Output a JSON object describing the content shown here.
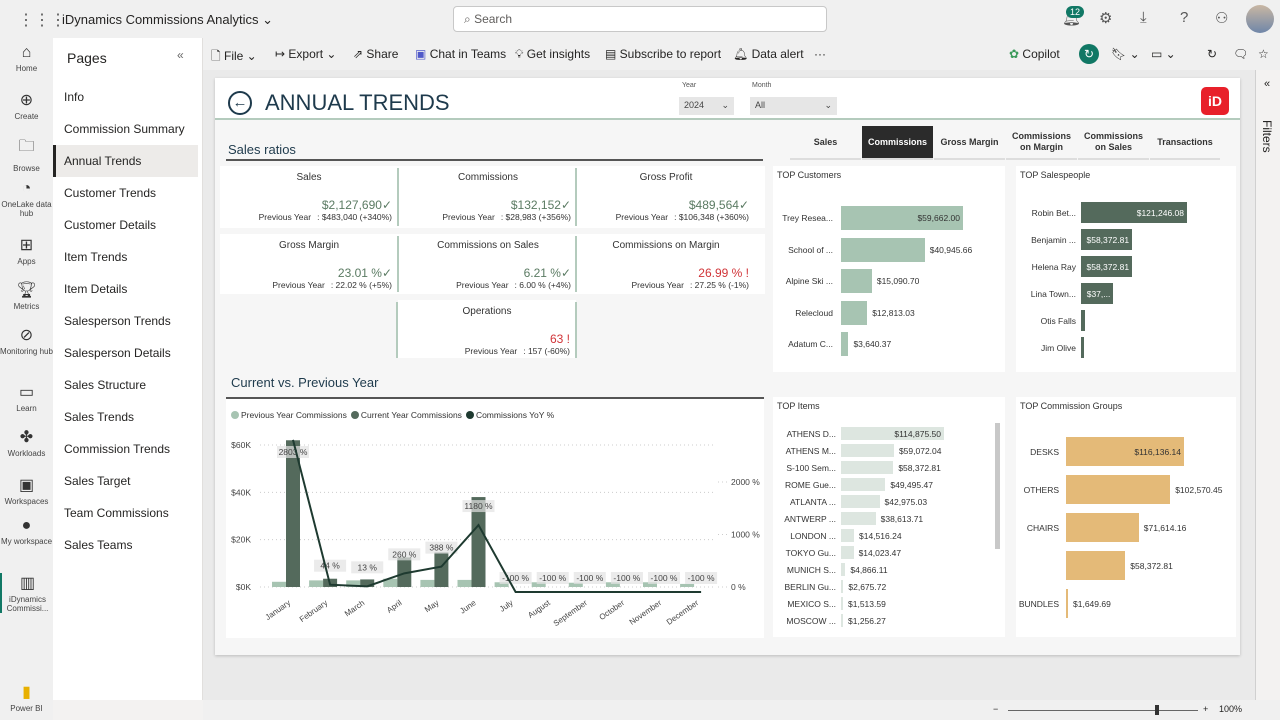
{
  "app": {
    "title": "iDynamics Commissions Analytics",
    "search_placeholder": "Search",
    "notification_count": "12"
  },
  "rail": [
    {
      "label": "Home",
      "icon": "home-icon"
    },
    {
      "label": "Create",
      "icon": "plus-icon"
    },
    {
      "label": "Browse",
      "icon": "folder-icon"
    },
    {
      "label": "OneLake data hub",
      "icon": "onelake-icon"
    },
    {
      "label": "Apps",
      "icon": "apps-icon"
    },
    {
      "label": "Metrics",
      "icon": "trophy-icon"
    },
    {
      "label": "Monitoring hub",
      "icon": "monitor-icon"
    },
    {
      "label": "Learn",
      "icon": "book-icon"
    },
    {
      "label": "Workloads",
      "icon": "workloads-icon"
    },
    {
      "label": "Workspaces",
      "icon": "workspaces-icon"
    },
    {
      "label": "My workspace",
      "icon": "avatar-icon"
    },
    {
      "label": "iDynamics Commissi...",
      "icon": "report-icon"
    },
    {
      "label": "Power BI",
      "icon": "powerbi-icon"
    }
  ],
  "pages": {
    "title": "Pages",
    "items": [
      "Info",
      "Commission Summary",
      "Annual Trends",
      "Customer Trends",
      "Customer Details",
      "Item Trends",
      "Item Details",
      "Salesperson Trends",
      "Salesperson Details",
      "Sales Structure",
      "Sales Trends",
      "Commission Trends",
      "Sales Target",
      "Team Commissions",
      "Sales Teams"
    ],
    "active": "Annual Trends"
  },
  "toolbar": {
    "file": "File",
    "export": "Export",
    "share": "Share",
    "chat": "Chat in Teams",
    "insights": "Get insights",
    "subscribe": "Subscribe to report",
    "alert": "Data alert",
    "more": "···",
    "copilot": "Copilot"
  },
  "filters": {
    "label": "Filters"
  },
  "report": {
    "title": "ANNUAL TRENDS",
    "logo_text": "iD",
    "slicers": {
      "year_label": "Year",
      "year_value": "2024",
      "month_label": "Month",
      "month_value": "All"
    },
    "sales_ratios_title": "Sales ratios",
    "kpis": [
      {
        "title": "Sales",
        "value": "$2,127,690",
        "status": "good",
        "prev_label": "Previous Year",
        "prev": ": $483,040 (+340%)"
      },
      {
        "title": "Commissions",
        "value": "$132,152",
        "status": "good",
        "prev_label": "Previous Year",
        "prev": ": $28,983 (+356%)"
      },
      {
        "title": "Gross Profit",
        "value": "$489,564",
        "status": "good",
        "prev_label": "Previous Year",
        "prev": ": $106,348 (+360%)"
      },
      {
        "title": "Gross Margin",
        "value": "23.01 %",
        "status": "good",
        "prev_label": "Previous Year",
        "prev": ": 22.02 % (+5%)"
      },
      {
        "title": "Commissions on Sales",
        "value": "6.21 %",
        "status": "good",
        "prev_label": "Previous Year",
        "prev": ": 6.00 % (+4%)"
      },
      {
        "title": "Commissions on Margin",
        "value": "26.99 %",
        "status": "bad",
        "prev_label": "Previous Year",
        "prev": ": 27.25 % (-1%)"
      },
      {
        "title": "Operations",
        "value": "63",
        "status": "bad",
        "prev_label": "Previous Year",
        "prev": ": 157 (-60%)"
      }
    ],
    "tabs": [
      "Sales",
      "Commissions",
      "Gross Margin",
      "Commissions on Margin",
      "Commissions on Sales",
      "Transactions"
    ],
    "active_tab": "Commissions"
  },
  "chart_data": [
    {
      "type": "bar+line",
      "title": "Current vs. Previous Year",
      "categories": [
        "January",
        "February",
        "March",
        "April",
        "May",
        "June",
        "July",
        "August",
        "September",
        "October",
        "November",
        "December"
      ],
      "series": [
        {
          "name": "Previous Year Commissions",
          "color": "#a7c4b2",
          "values": [
            2200,
            2800,
            2800,
            3500,
            3000,
            3000,
            2000,
            2000,
            1800,
            2000,
            2000,
            1300
          ]
        },
        {
          "name": "Current Year Commissions",
          "color": "#546a5c",
          "values": [
            62000,
            3500,
            3200,
            12500,
            14600,
            38000,
            0,
            0,
            0,
            0,
            0,
            0
          ]
        },
        {
          "name": "Commissions YoY %",
          "color": "#1e3a30",
          "axis": "right",
          "values": [
            2803,
            44,
            13,
            260,
            388,
            1180,
            -100,
            -100,
            -100,
            -100,
            -100,
            -100
          ],
          "labels": [
            "2803 %",
            "44 %",
            "13 %",
            "260 %",
            "388 %",
            "1180 %",
            "-100 %",
            "-100 %",
            "-100 %",
            "-100 %",
            "-100 %",
            "-100 %"
          ]
        }
      ],
      "y_left": {
        "ticks": [
          "$0K",
          "$20K",
          "$40K",
          "$60K"
        ],
        "range": [
          0,
          60000
        ]
      },
      "y_right": {
        "ticks": [
          "0 %",
          "1000 %",
          "2000 %"
        ],
        "range": [
          0,
          2000
        ]
      }
    },
    {
      "type": "bar",
      "orientation": "horizontal",
      "title": "TOP Customers",
      "color": "#a7c4b2",
      "categories": [
        "Trey Resea...",
        "School of ...",
        "Alpine Ski ...",
        "Relecloud",
        "Adatum C..."
      ],
      "values": [
        59662.0,
        40945.66,
        15090.7,
        12813.03,
        3640.37
      ],
      "labels": [
        "$59,662.00",
        "$40,945.66",
        "$15,090.70",
        "$12,813.03",
        "$3,640.37"
      ]
    },
    {
      "type": "bar",
      "orientation": "horizontal",
      "title": "TOP Salespeople",
      "color": "#546a5c",
      "categories": [
        "Robin Bet...",
        "Benjamin ...",
        "Helena Ray",
        "Lina Town...",
        "Otis Falls",
        "Jim Olive"
      ],
      "values": [
        121246.08,
        58372.81,
        58372.81,
        37000,
        5000,
        4000
      ],
      "labels": [
        "$121,246.08",
        "$58,372.81",
        "$58,372.81",
        "$37,...",
        "",
        ""
      ]
    },
    {
      "type": "bar",
      "orientation": "horizontal",
      "title": "TOP Items",
      "color": "#dde6e0",
      "categories": [
        "ATHENS D...",
        "ATHENS M...",
        "S-100 Sem...",
        "ROME Gue...",
        "ATLANTA ...",
        "ANTWERP ...",
        "LONDON ...",
        "TOKYO Gu...",
        "MUNICH S...",
        "BERLIN Gu...",
        "MEXICO S...",
        "MOSCOW ..."
      ],
      "values": [
        114875.5,
        59072.04,
        58372.81,
        49495.47,
        42975.03,
        38613.71,
        14516.24,
        14023.47,
        4866.11,
        2675.72,
        1513.59,
        1256.27
      ],
      "labels": [
        "$114,875.50",
        "$59,072.04",
        "$58,372.81",
        "$49,495.47",
        "$42,975.03",
        "$38,613.71",
        "$14,516.24",
        "$14,023.47",
        "$4,866.11",
        "$2,675.72",
        "$1,513.59",
        "$1,256.27"
      ]
    },
    {
      "type": "bar",
      "orientation": "horizontal",
      "title": "TOP Commission Groups",
      "color": "#e4ba78",
      "categories": [
        "DESKS",
        "OTHERS",
        "CHAIRS",
        "",
        "BUNDLES"
      ],
      "values": [
        116136.14,
        102570.45,
        71614.16,
        58372.81,
        1649.69
      ],
      "labels": [
        "$116,136.14",
        "$102,570.45",
        "$71,614.16",
        "$58,372.81",
        "$1,649.69"
      ]
    }
  ],
  "status": {
    "zoom": "100%",
    "minus": "−",
    "plus": "+"
  }
}
